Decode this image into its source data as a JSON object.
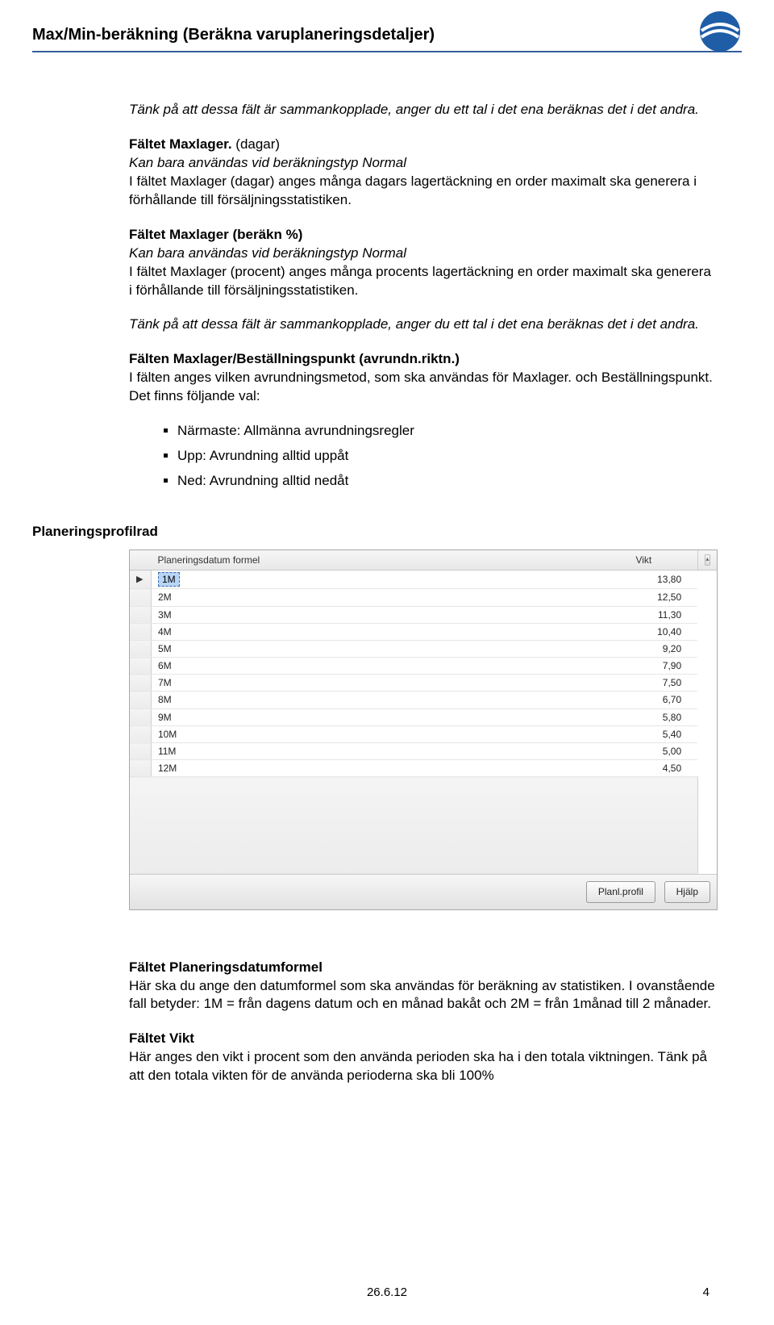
{
  "header": {
    "title": "Max/Min-beräkning (Beräkna varuplaneringsdetaljer)"
  },
  "p1": "Tänk på att dessa fält är sammankopplade, anger du ett tal i det ena beräknas det i det andra.",
  "h1": "Fältet Maxlager. ",
  "h1b": "(dagar)",
  "p2a": "Kan bara användas vid beräkningstyp Normal",
  "p2b": "I fältet Maxlager (dagar) anges många dagars lagertäckning en order maximalt ska generera i förhållande till försäljningsstatistiken.",
  "h2": "Fältet Maxlager (beräkn %)",
  "p3a": "Kan bara användas vid beräkningstyp Normal",
  "p3b": "I fältet Maxlager (procent) anges många procents lagertäckning en order maximalt ska generera i förhållande till försäljningsstatistiken.",
  "p4": "Tänk på att dessa fält är sammankopplade, anger du ett tal i det ena beräknas det i det andra.",
  "h3": "Fälten Maxlager/Beställningspunkt (avrundn.riktn.)",
  "p5": "I fälten anges vilken avrundningsmetod, som ska användas för Maxlager. och Beställningspunkt.",
  "p5b": "Det finns följande val:",
  "list": [
    "Närmaste: Allmänna avrundningsregler",
    "Upp: Avrundning alltid uppåt",
    "Ned: Avrundning alltid nedåt"
  ],
  "section_heading": "Planeringsprofilrad",
  "grid": {
    "col1": "Planeringsdatum formel",
    "col2": "Vikt",
    "rows": [
      {
        "formel": "1M",
        "vikt": "13,80"
      },
      {
        "formel": "2M",
        "vikt": "12,50"
      },
      {
        "formel": "3M",
        "vikt": "11,30"
      },
      {
        "formel": "4M",
        "vikt": "10,40"
      },
      {
        "formel": "5M",
        "vikt": "9,20"
      },
      {
        "formel": "6M",
        "vikt": "7,90"
      },
      {
        "formel": "7M",
        "vikt": "7,50"
      },
      {
        "formel": "8M",
        "vikt": "6,70"
      },
      {
        "formel": "9M",
        "vikt": "5,80"
      },
      {
        "formel": "10M",
        "vikt": "5,40"
      },
      {
        "formel": "11M",
        "vikt": "5,00"
      },
      {
        "formel": "12M",
        "vikt": "4,50"
      }
    ],
    "btn1": "Planl.profil",
    "btn2": "Hjälp"
  },
  "h4": "Fältet Planeringsdatumformel",
  "p6": "Här ska du ange den datumformel som ska användas för beräkning av statistiken. I ovanstående fall betyder: 1M = från dagens datum och en månad bakåt och 2M = från 1månad till 2 månader.",
  "h5": "Fältet Vikt",
  "p7": "Här anges den vikt i procent som den använda perioden ska ha i den totala viktningen. Tänk på att den totala vikten för de använda perioderna ska bli 100%",
  "footer": {
    "date": "26.6.12",
    "page": "4"
  }
}
